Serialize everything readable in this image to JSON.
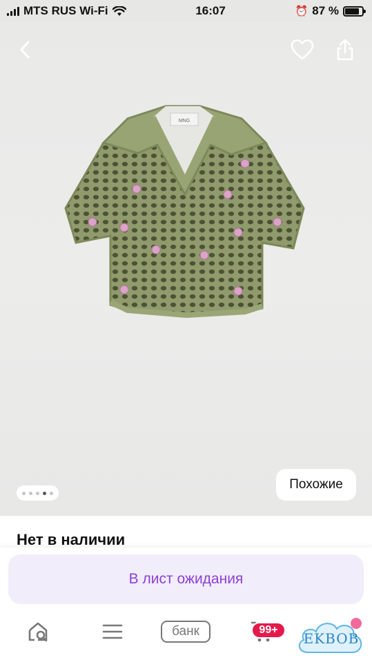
{
  "status_bar": {
    "carrier": "MTS RUS Wi-Fi",
    "time": "16:07",
    "battery_percent": "87 %",
    "battery_level": 0.87
  },
  "gallery": {
    "similar_label": "Похожие",
    "image_count": 5,
    "active_index": 3,
    "product_tag": "MNG"
  },
  "availability": {
    "status": "Нет в наличии"
  },
  "waitlist": {
    "label": "В лист ожидания",
    "color": "#8c3fd6"
  },
  "bottom_nav": {
    "bank_label": "банк",
    "cart_badge": "99+",
    "badge_color": "#e5194b"
  },
  "watermark": {
    "text": "EKBOB"
  }
}
